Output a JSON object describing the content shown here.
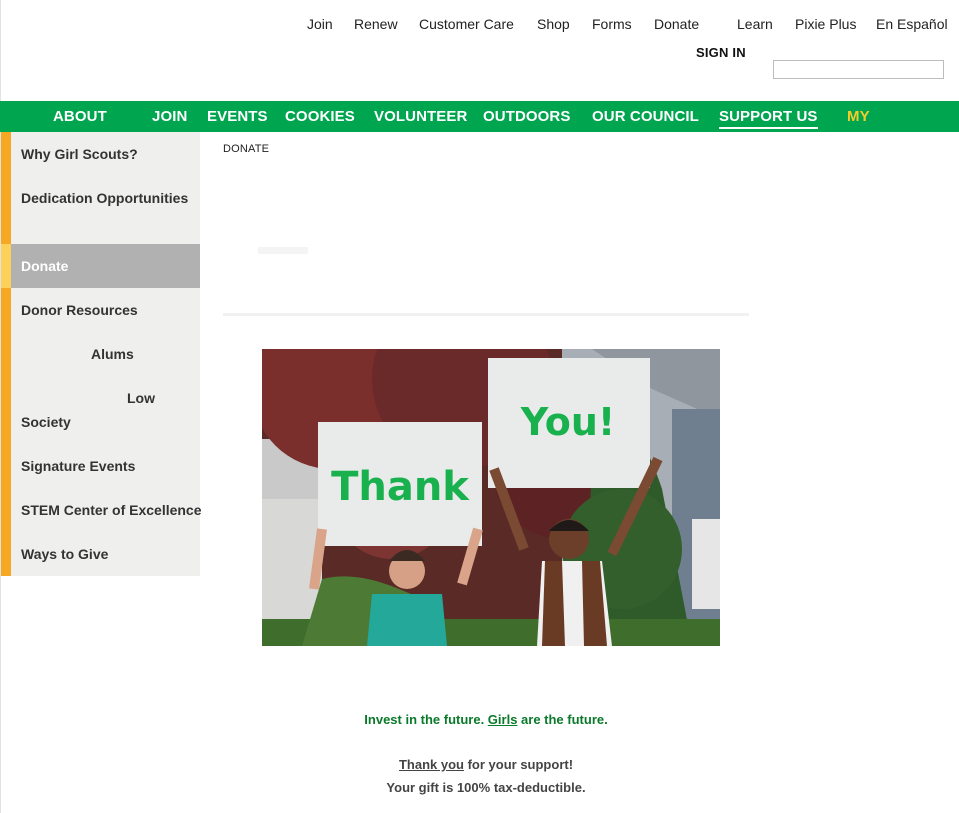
{
  "utility_nav": [
    {
      "id": "join",
      "label": "Join"
    },
    {
      "id": "renew",
      "label": "Renew"
    },
    {
      "id": "customer-care",
      "label": "Customer Care"
    },
    {
      "id": "shop",
      "label": "Shop"
    },
    {
      "id": "forms",
      "label": "Forms"
    },
    {
      "id": "donate",
      "label": "Donate"
    },
    {
      "id": "learn",
      "label": "Learn"
    },
    {
      "id": "pixie-plus",
      "label": "Pixie Plus"
    },
    {
      "id": "en-espanol",
      "label": "En Español"
    }
  ],
  "signin_label": "SIGN IN",
  "search": {
    "value": "",
    "placeholder": ""
  },
  "main_nav": [
    {
      "id": "about",
      "label": "ABOUT"
    },
    {
      "id": "join",
      "label": "JOIN"
    },
    {
      "id": "events",
      "label": "EVENTS"
    },
    {
      "id": "cookies",
      "label": "COOKIES"
    },
    {
      "id": "volunteer",
      "label": "VOLUNTEER"
    },
    {
      "id": "outdoors",
      "label": "OUTDOORS"
    },
    {
      "id": "our-council",
      "label": "OUR COUNCIL"
    },
    {
      "id": "support-us",
      "label": "SUPPORT US",
      "active": true
    },
    {
      "id": "my",
      "label": "MY"
    }
  ],
  "sidebar": {
    "items": [
      {
        "id": "why-girl-scouts",
        "label": "Why Girl Scouts?"
      },
      {
        "id": "dedication-opportunities",
        "label": "Dedication Opportunities"
      },
      {
        "id": "donate",
        "label": "Donate",
        "active": true
      },
      {
        "id": "donor-resources",
        "label": "Donor Resources"
      },
      {
        "id": "alums",
        "label": "Alums"
      },
      {
        "id": "low",
        "label": "Low"
      },
      {
        "id": "society",
        "label": "Society"
      },
      {
        "id": "signature-events",
        "label": "Signature Events"
      },
      {
        "id": "stem-center",
        "label": "STEM Center of Excellence"
      },
      {
        "id": "ways-to-give",
        "label": "Ways to Give"
      }
    ]
  },
  "breadcrumb": "DONATE",
  "photo": {
    "sign_left": "Thank",
    "sign_right": "You!",
    "colors": {
      "sign_text": "#18b14e",
      "sign": "#e9ebea",
      "vest_left": "#23a89a",
      "vest_right": "#6a3b24",
      "foliage": "#6b2a2a"
    }
  },
  "tagline": {
    "part1": "Invest in the future. ",
    "link": "Girls",
    "part2": " are the future."
  },
  "thanks": {
    "link": "Thank you",
    "rest": " for your support!"
  },
  "tax_note": "Your gift is 100% tax-deductible.",
  "colors": {
    "nav_green": "#00a550",
    "sidebar_accent": "#f7a823",
    "active_bg": "#b1b1b1",
    "my_yellow": "#f5cd2a",
    "tagline_green": "#0a7a2a"
  }
}
